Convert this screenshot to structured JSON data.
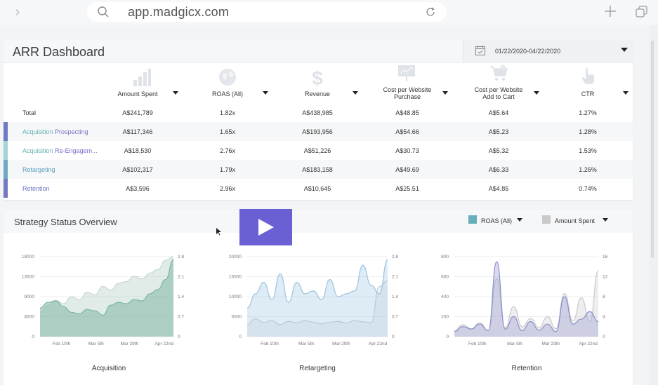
{
  "browser": {
    "url": "app.madgicx.com"
  },
  "dashboard": {
    "title": "ARR Dashboard",
    "date_range": "01/22/2020-04/22/2020",
    "metrics": [
      {
        "label": "Amount Spent",
        "icon": "bar-chart-icon"
      },
      {
        "label": "ROAS (All)",
        "icon": "globe-icon"
      },
      {
        "label": "Revenue",
        "icon": "dollar-icon"
      },
      {
        "label": "Cost per Website Purchase",
        "icon": "presentation-chart-icon"
      },
      {
        "label": "Cost per Website Add to Cart",
        "icon": "cart-icon"
      },
      {
        "label": "CTR",
        "icon": "hand-pointer-icon"
      }
    ],
    "rows": [
      {
        "name": "Total",
        "name_parts": [
          "Total"
        ],
        "values": [
          "A$241,789",
          "1.82x",
          "A$438,985",
          "A$48.85",
          "A$5.64",
          "1.27%"
        ],
        "bar_color": ""
      },
      {
        "name": "Acquisition Prospecting",
        "name_parts": [
          "Acquisition",
          "Prospecting"
        ],
        "values": [
          "A$117,346",
          "1.65x",
          "A$193,956",
          "A$54.66",
          "A$5.23",
          "1.28%"
        ],
        "bar_color": "#6f7bc6"
      },
      {
        "name": "Acquisition Re-Engagem...",
        "name_parts": [
          "Acquisition",
          "Re-Engagem..."
        ],
        "values": [
          "A$18,530",
          "2.76x",
          "A$51,226",
          "A$30.73",
          "A$5.32",
          "1.53%"
        ],
        "bar_color": "#a6d4d4"
      },
      {
        "name": "Retargeting",
        "name_parts": [
          "Retargeting"
        ],
        "values": [
          "A$102,317",
          "1.79x",
          "A$183,158",
          "A$49.69",
          "A$6.33",
          "1.26%"
        ],
        "bar_color": "#6fa9c6"
      },
      {
        "name": "Retention",
        "name_parts": [
          "Retention"
        ],
        "values": [
          "A$3,596",
          "2.96x",
          "A$10,645",
          "A$25.51",
          "A$4.85",
          "0.74%"
        ],
        "bar_color": "#7479c2"
      }
    ]
  },
  "strategy": {
    "title": "Strategy Status Overview",
    "legend": [
      {
        "label": "ROAS (All)",
        "color": "#6fa9c6"
      },
      {
        "label": "Amount Spent",
        "color": "#c9c9c9"
      }
    ]
  },
  "colors": {
    "teal": "#5fb3b0",
    "green": "#7ab8a0",
    "purple": "#7a6fc7",
    "blue": "#6fa9c6",
    "play": "#6b5fd4"
  },
  "chart_data": [
    {
      "type": "area",
      "title": "Acquisition",
      "x": [
        "Feb 10th",
        "Mar 5th",
        "Mar 29th",
        "Apr 22nd"
      ],
      "y_left_ticks": [
        "18000",
        "13500",
        "9000",
        "4500",
        "0"
      ],
      "y_right_ticks": [
        "2.8",
        "2.1",
        "1.4",
        "0.7",
        "0"
      ],
      "ylim_left": [
        0,
        18000
      ],
      "ylim_right": [
        0,
        2.8
      ],
      "series": [
        {
          "name": "Amount Spent",
          "axis": "left",
          "values": [
            5500,
            7000,
            8200,
            7400,
            9000,
            8300,
            10000,
            9400,
            11300,
            10500,
            12000,
            12400,
            13600,
            13000,
            14300,
            15100,
            17200,
            18000
          ]
        },
        {
          "name": "ROAS (All)",
          "axis": "right",
          "values": [
            1.0,
            1.2,
            1.25,
            1.05,
            0.85,
            0.8,
            0.95,
            0.9,
            0.75,
            1.1,
            1.2,
            1.15,
            1.3,
            1.25,
            1.5,
            1.65,
            2.0,
            2.7
          ]
        }
      ]
    },
    {
      "type": "area",
      "title": "Retargeting",
      "x": [
        "Feb 10th",
        "Mar 5th",
        "Mar 29th",
        "Apr 22nd"
      ],
      "y_left_ticks": [
        "20000",
        "15000",
        "10000",
        "5000",
        "0"
      ],
      "y_right_ticks": [
        "2.8",
        "2.1",
        "1.4",
        "0.7",
        "0"
      ],
      "ylim_left": [
        0,
        20000
      ],
      "ylim_right": [
        0,
        2.8
      ],
      "series": [
        {
          "name": "Amount Spent",
          "axis": "left",
          "values": [
            3000,
            4500,
            3500,
            4000,
            3000,
            3800,
            3500,
            4000,
            3600,
            3200,
            3600,
            3800,
            3400,
            4000,
            3700,
            3500,
            12500,
            14000
          ]
        },
        {
          "name": "ROAS (All)",
          "axis": "right",
          "values": [
            1.0,
            1.5,
            1.9,
            1.3,
            2.2,
            1.2,
            1.9,
            1.5,
            1.6,
            1.3,
            2.0,
            1.4,
            1.5,
            1.6,
            2.5,
            1.8,
            1.5,
            2.7
          ]
        }
      ]
    },
    {
      "type": "area",
      "title": "Retention",
      "x": [
        "Feb 10th",
        "Mar 5th",
        "Mar 29th",
        "Apr 22nd"
      ],
      "y_left_ticks": [
        "800",
        "600",
        "400",
        "200",
        "0"
      ],
      "y_right_ticks": [
        "16",
        "12",
        "8",
        "4",
        "0"
      ],
      "ylim_left": [
        0,
        800
      ],
      "ylim_right": [
        0,
        16
      ],
      "series": [
        {
          "name": "Amount Spent",
          "axis": "left",
          "values": [
            60,
            120,
            80,
            140,
            60,
            580,
            90,
            300,
            100,
            180,
            90,
            200,
            80,
            430,
            160,
            390,
            150,
            660
          ]
        },
        {
          "name": "ROAS (All)",
          "axis": "right",
          "values": [
            1.0,
            2.0,
            1.5,
            2.5,
            1.2,
            15.0,
            1.5,
            4.0,
            1.2,
            3.0,
            1.3,
            2.5,
            1.0,
            8.0,
            2.5,
            3.5,
            5.0,
            3.0
          ]
        }
      ]
    }
  ]
}
